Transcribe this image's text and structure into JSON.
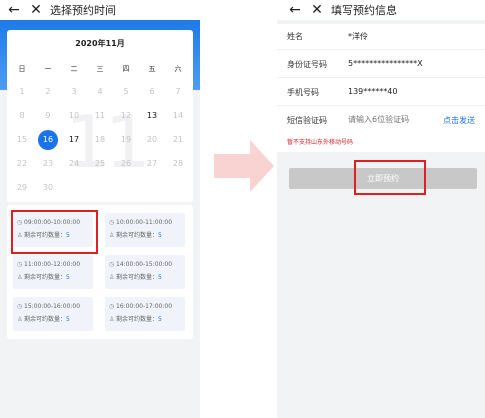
{
  "left": {
    "title": "选择预约时间",
    "back_icon": "←",
    "close_icon": "✕",
    "calendar": {
      "title": "2020年11月",
      "weekdays": [
        "日",
        "一",
        "二",
        "三",
        "四",
        "五",
        "六"
      ],
      "watermark": "11",
      "rows": [
        [
          {
            "d": "1",
            "s": "off"
          },
          {
            "d": "2",
            "s": "off"
          },
          {
            "d": "3",
            "s": "off"
          },
          {
            "d": "4",
            "s": "off"
          },
          {
            "d": "5",
            "s": "off"
          },
          {
            "d": "6",
            "s": "off"
          },
          {
            "d": "7",
            "s": "off"
          }
        ],
        [
          {
            "d": "8",
            "s": "off"
          },
          {
            "d": "9",
            "s": "off"
          },
          {
            "d": "10",
            "s": "off"
          },
          {
            "d": "11",
            "s": "off"
          },
          {
            "d": "12",
            "s": "off"
          },
          {
            "d": "13",
            "s": "avail"
          },
          {
            "d": "14",
            "s": "off"
          }
        ],
        [
          {
            "d": "15",
            "s": "off"
          },
          {
            "d": "16",
            "s": "sel"
          },
          {
            "d": "17",
            "s": "avail"
          },
          {
            "d": "18",
            "s": "off"
          },
          {
            "d": "19",
            "s": "off"
          },
          {
            "d": "20",
            "s": "off"
          },
          {
            "d": "21",
            "s": "off"
          }
        ],
        [
          {
            "d": "22",
            "s": "off"
          },
          {
            "d": "23",
            "s": "off"
          },
          {
            "d": "24",
            "s": "off"
          },
          {
            "d": "25",
            "s": "off"
          },
          {
            "d": "26",
            "s": "off"
          },
          {
            "d": "27",
            "s": "off"
          },
          {
            "d": "28",
            "s": "off"
          }
        ],
        [
          {
            "d": "29",
            "s": "off"
          },
          {
            "d": "30",
            "s": "off"
          }
        ]
      ]
    },
    "slots": [
      {
        "time": "09:00:00-10:00:00",
        "remain_label": "剩余可约数量：",
        "count": "5"
      },
      {
        "time": "10:00:00-11:00:00",
        "remain_label": "剩余可约数量：",
        "count": "5"
      },
      {
        "time": "11:00:00-12:00:00",
        "remain_label": "剩余可约数量：",
        "count": "5"
      },
      {
        "time": "14:00:00-15:00:00",
        "remain_label": "剩余可约数量：",
        "count": "5"
      },
      {
        "time": "15:00:00-16:00:00",
        "remain_label": "剩余可约数量：",
        "count": "5"
      },
      {
        "time": "16:00:00-17:00:00",
        "remain_label": "剩余可约数量：",
        "count": "5"
      }
    ]
  },
  "right": {
    "title": "填写预约信息",
    "back_icon": "←",
    "close_icon": "✕",
    "fields": {
      "name_label": "姓名",
      "name_value": "*洋伶",
      "id_label": "身份证号码",
      "id_value": "5****************X",
      "phone_label": "手机号码",
      "phone_value": "139******40",
      "sms_label": "短信验证码",
      "sms_placeholder": "请输入6位验证码",
      "send_label": "点击发送"
    },
    "warning": "暂不支持山东外移动号码",
    "submit_label": "立即预约"
  },
  "colors": {
    "accent": "#1a73e8",
    "header_gradient_top": "#1e7ae8",
    "highlight_red": "#e02020",
    "arrow": "#f9d2d2",
    "button_disabled": "#c8c8c8"
  }
}
